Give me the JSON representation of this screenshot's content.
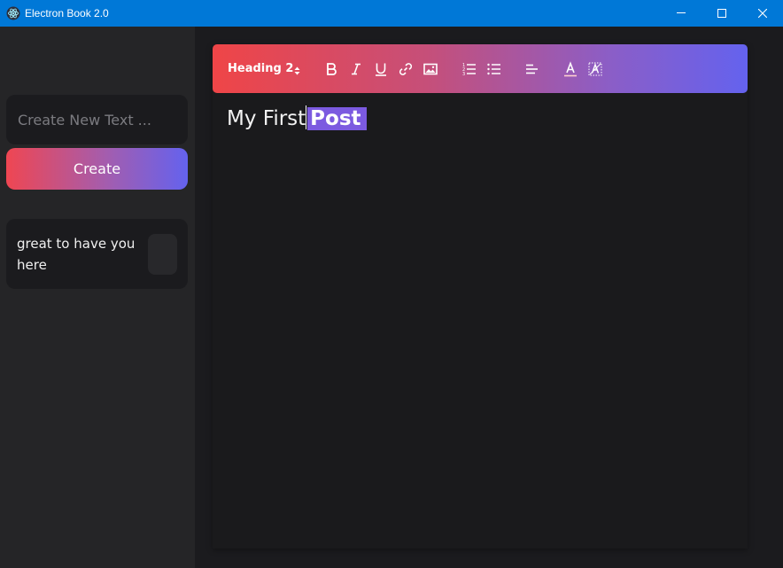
{
  "window": {
    "title": "Electron Book 2.0",
    "icon": "electron-icon"
  },
  "sidebar": {
    "new_input_placeholder": "Create New Text ...",
    "create_label": "Create",
    "notes": [
      {
        "text": "great to have you here"
      }
    ]
  },
  "toolbar": {
    "heading_value": "Heading 2",
    "buttons": [
      "bold-icon",
      "italic-icon",
      "underline-icon",
      "link-icon",
      "image-icon",
      "ordered-list-icon",
      "bullet-list-icon",
      "align-left-icon",
      "text-color-icon",
      "clear-format-icon"
    ]
  },
  "editor": {
    "text_before": "My First",
    "text_selected": "Post"
  },
  "colors": {
    "titlebar": "#0078d7",
    "gradient_start": "#ef4547",
    "gradient_end": "#6462ee",
    "selection": "#7c5ae0"
  }
}
